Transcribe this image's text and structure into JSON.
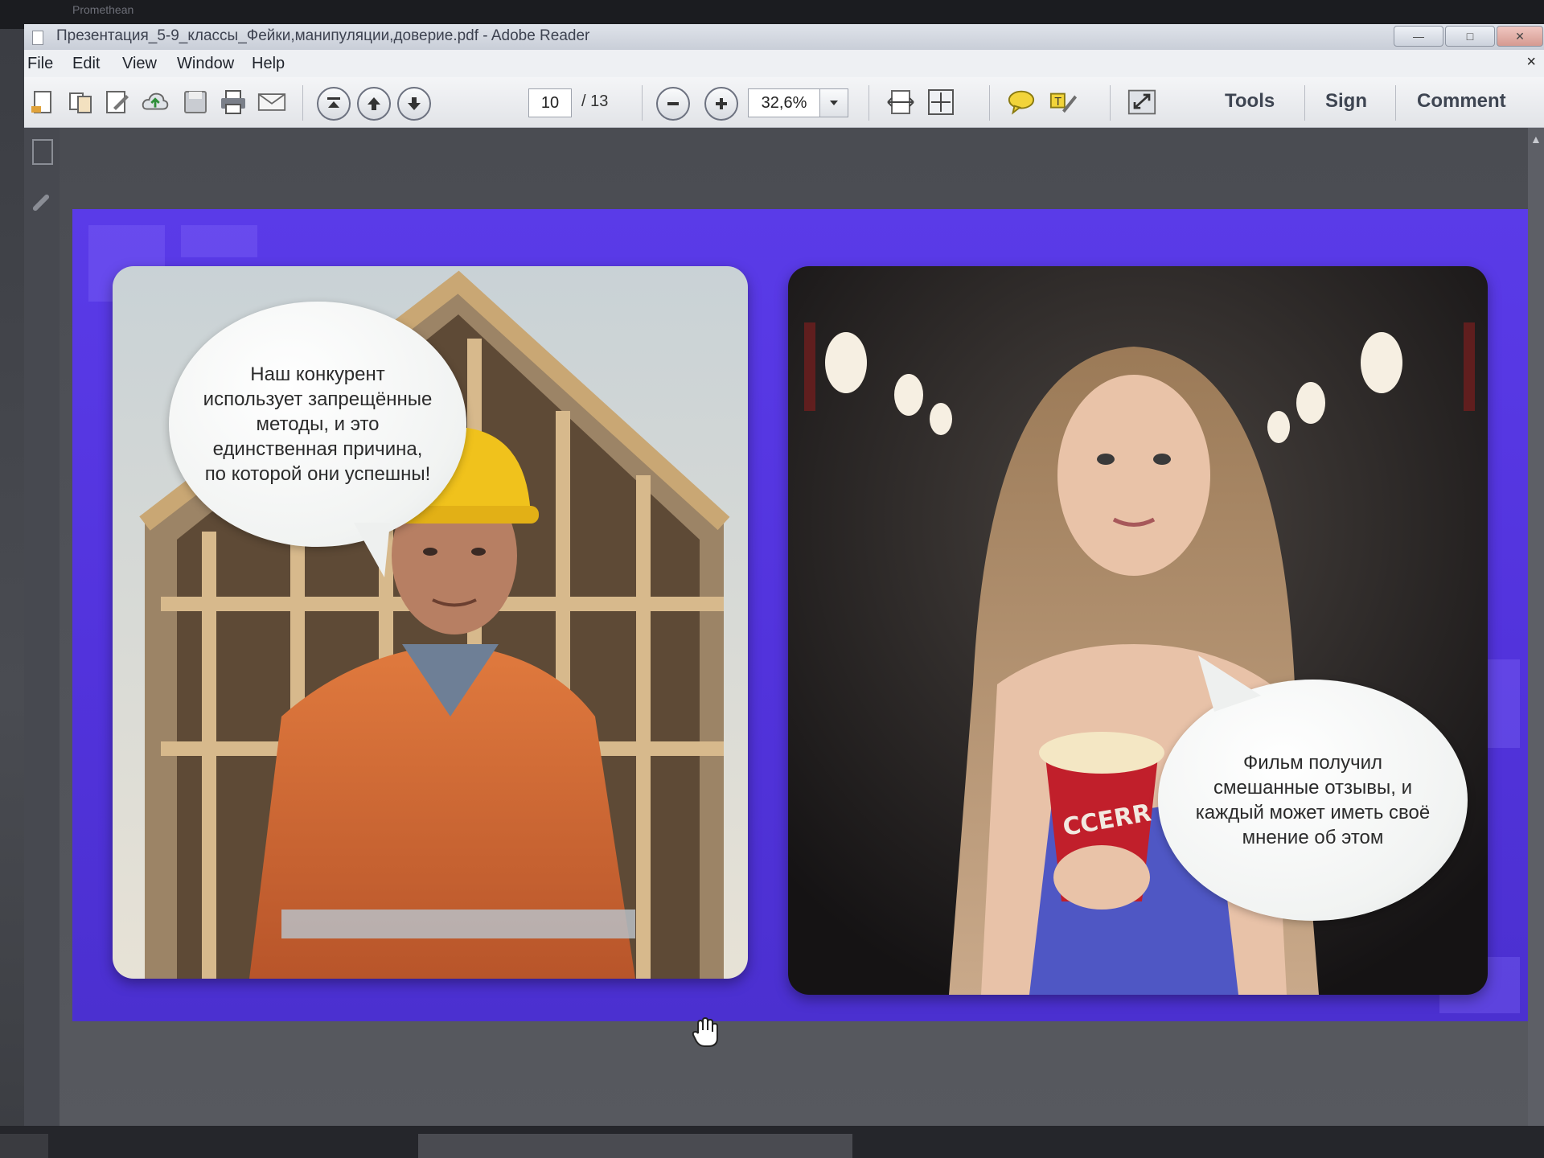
{
  "app": {
    "top_strip_label": "Promethean",
    "window_title": "Презентация_5-9_классы_Фейки,манипуляции,доверие.pdf - Adobe Reader"
  },
  "menu": {
    "items": [
      "File",
      "Edit",
      "View",
      "Window",
      "Help"
    ],
    "close_glyph": "×"
  },
  "toolbar": {
    "current_page": "10",
    "total_pages": "/ 13",
    "zoom": "32,6%",
    "tools_label": "Tools",
    "sign_label": "Sign",
    "comment_label": "Comment"
  },
  "slide": {
    "left_bubble_text": "Наш конкурент использует запрещённые методы, и это единственная причина, по которой они успешны!",
    "right_bubble_text": "Фильм получил смешанные отзывы, и каждый может иметь своё мнение об этом",
    "popcorn_label": "CCERR CK"
  },
  "colors": {
    "slide_bg": "#5534e0",
    "toolbar_bg": "#e9ebee"
  }
}
